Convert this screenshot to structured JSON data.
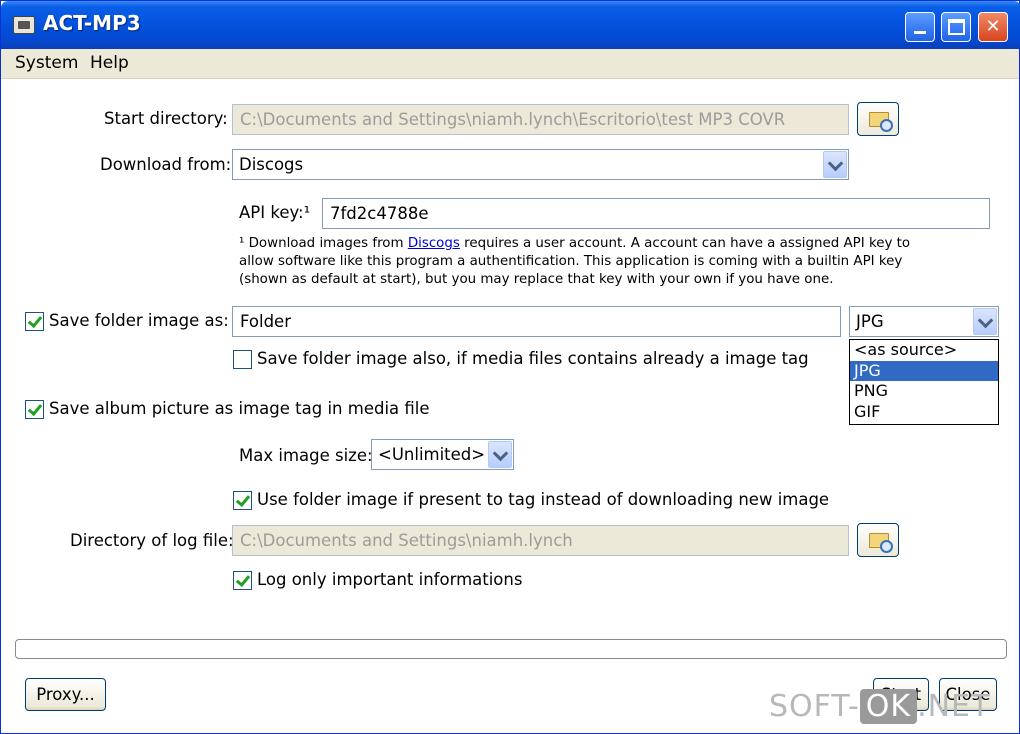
{
  "window": {
    "title": "ACT-MP3"
  },
  "menu": {
    "system": "System",
    "help": "Help"
  },
  "start_dir": {
    "label": "Start directory:",
    "value": "C:\\Documents and Settings\\niamh.lynch\\Escritorio\\test MP3 COVR"
  },
  "download": {
    "label": "Download from:",
    "value": "Discogs"
  },
  "api": {
    "label": "API key:¹",
    "value": "7fd2c4788e"
  },
  "note": {
    "prefix": "¹ Download images from ",
    "link": "Discogs",
    "rest": " requires a user account. A account can have a assigned API key to allow software like this program a authentification. This application is coming with a builtin API key (shown as default at start), but you may replace that key with your own if you have one."
  },
  "save_folder": {
    "label": "Save folder image as:",
    "checked": true,
    "value": "Folder",
    "format": "JPG"
  },
  "format_options": [
    "<as source>",
    "JPG",
    "PNG",
    "GIF"
  ],
  "format_selected_index": 1,
  "save_also": {
    "label": "Save folder image also, if media files contains already a image tag",
    "checked": false
  },
  "save_album": {
    "label": "Save album picture as image tag in media file",
    "checked": true
  },
  "max_size": {
    "label": "Max image size:",
    "value": "<Unlimited>"
  },
  "use_folder": {
    "label": "Use folder image if present to tag instead of downloading new image",
    "checked": true
  },
  "log_dir": {
    "label": "Directory of log file:",
    "value": "C:\\Documents and Settings\\niamh.lynch"
  },
  "log_only": {
    "label": "Log only important informations",
    "checked": true
  },
  "buttons": {
    "proxy": "Proxy...",
    "start": "Start",
    "close": "Close"
  },
  "watermark": {
    "left": "SOFT-",
    "mid": "OK",
    "right": ".NET"
  }
}
